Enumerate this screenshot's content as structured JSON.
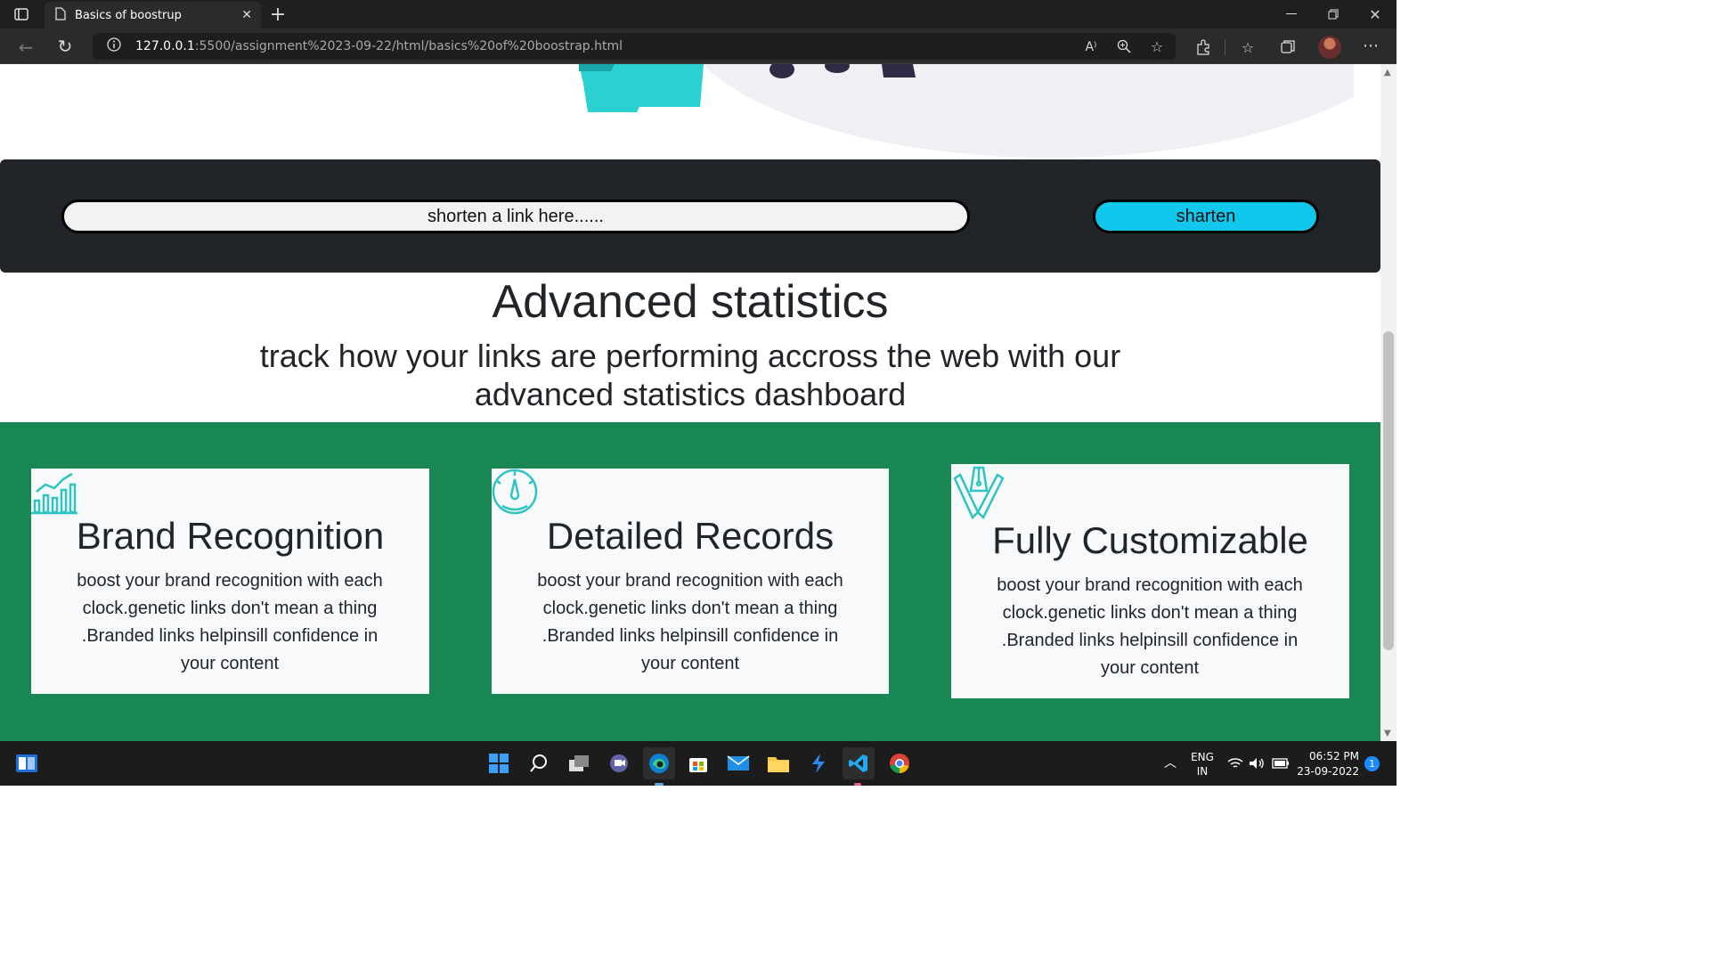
{
  "browser": {
    "tab_title": "Basics of boostrup",
    "url_host": "127.0.0.1",
    "url_path": ":5500/assignment%2023-09-22/html/basics%20of%20boostrap.html",
    "read_aloud_label": "A⁾"
  },
  "shortener": {
    "input_placeholder": "shorten a link here......",
    "button_label": "sharten"
  },
  "stats": {
    "title": "Advanced statistics",
    "subtitle": "track how your links are performing accross the web with our advanced statistics dashboard"
  },
  "cards": [
    {
      "title": "Brand Recognition",
      "body": "boost your brand recognition with each clock.genetic links don't mean a thing .Branded links helpinsill confidence in your content",
      "icon": "chart-icon"
    },
    {
      "title": "Detailed Records",
      "body": "boost your brand recognition with each clock.genetic links don't mean a thing .Branded links helpinsill confidence in your content",
      "icon": "gauge-icon"
    },
    {
      "title": "Fully Customizable",
      "body": "boost your brand recognition with each clock.genetic links don't mean a thing .Branded links helpinsill confidence in your content",
      "icon": "brush-pen-icon"
    }
  ],
  "taskbar": {
    "language": "ENG",
    "region": "IN",
    "time": "06:52 PM",
    "date": "23-09-2022",
    "notification_count": "1"
  },
  "colors": {
    "dark_panel": "#212529",
    "accent_cyan": "#11c7ec",
    "green_section": "#198754",
    "card_bg": "#f8f9fa",
    "icon_teal": "#2ec4c4"
  }
}
